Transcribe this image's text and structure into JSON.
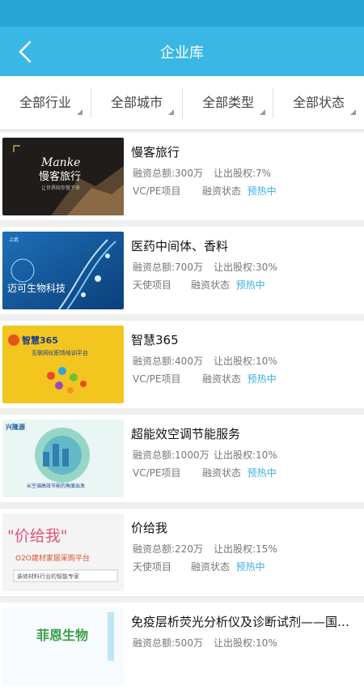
{
  "header": {
    "title": "企业库"
  },
  "filters": [
    {
      "label": "全部行业"
    },
    {
      "label": "全部城市"
    },
    {
      "label": "全部类型"
    },
    {
      "label": "全部状态"
    }
  ],
  "projects": [
    {
      "name": "慢客旅行",
      "financing": "融资总额:300万",
      "equity": "让出股权:7%",
      "type": "VC/PE项目",
      "status_label": "融资状态",
      "status": "预热中",
      "image_text": "Manke",
      "image_subtext": "慢客旅行",
      "image_caption": "让世界陪你慢下来"
    },
    {
      "name": "医药中间体、香料",
      "financing": "融资总额:700万",
      "equity": "让出股权:30%",
      "type": "天使项目",
      "status_label": "融资状态",
      "status": "预热中",
      "image_text": "迈可生物科技",
      "image_subtext": "上武"
    },
    {
      "name": "智慧365",
      "financing": "融资总额:400万",
      "equity": "让出股权:10%",
      "type": "VC/PE项目",
      "status_label": "融资状态",
      "status": "预热中",
      "image_text": "智慧365",
      "image_subtext": "互联网化职场培训平台"
    },
    {
      "name": "超能效空调节能服务",
      "financing": "融资总额:1000万",
      "equity": "让出股权:10%",
      "type": "VC/PE项目",
      "status_label": "融资状态",
      "status": "预热中",
      "image_text": "兴隆源",
      "image_caption": "从空调高效节能的角度出发"
    },
    {
      "name": "价给我",
      "financing": "融资总额:220万",
      "equity": "让出股权:15%",
      "type": "天使项目",
      "status_label": "融资状态",
      "status": "预热中",
      "image_text": "\"价给我\"",
      "image_subtext": "O2O建材家居采购平台",
      "image_caption": "装修材料行业的智能专家"
    },
    {
      "name": "免疫层析荧光分析仪及诊断试剂——国内专...",
      "financing": "融资总额:500万",
      "equity": "让出股权:10%",
      "type": "",
      "status_label": "",
      "status": "",
      "image_text": "菲恩生物"
    }
  ],
  "colors": {
    "accent": "#3bb7e6",
    "status_bar": "#25a6d4",
    "status_highlight": "#3bb0e2"
  },
  "icons": {
    "back": "chevron-left-icon",
    "filter_indicator": "corner-triangle-icon"
  }
}
